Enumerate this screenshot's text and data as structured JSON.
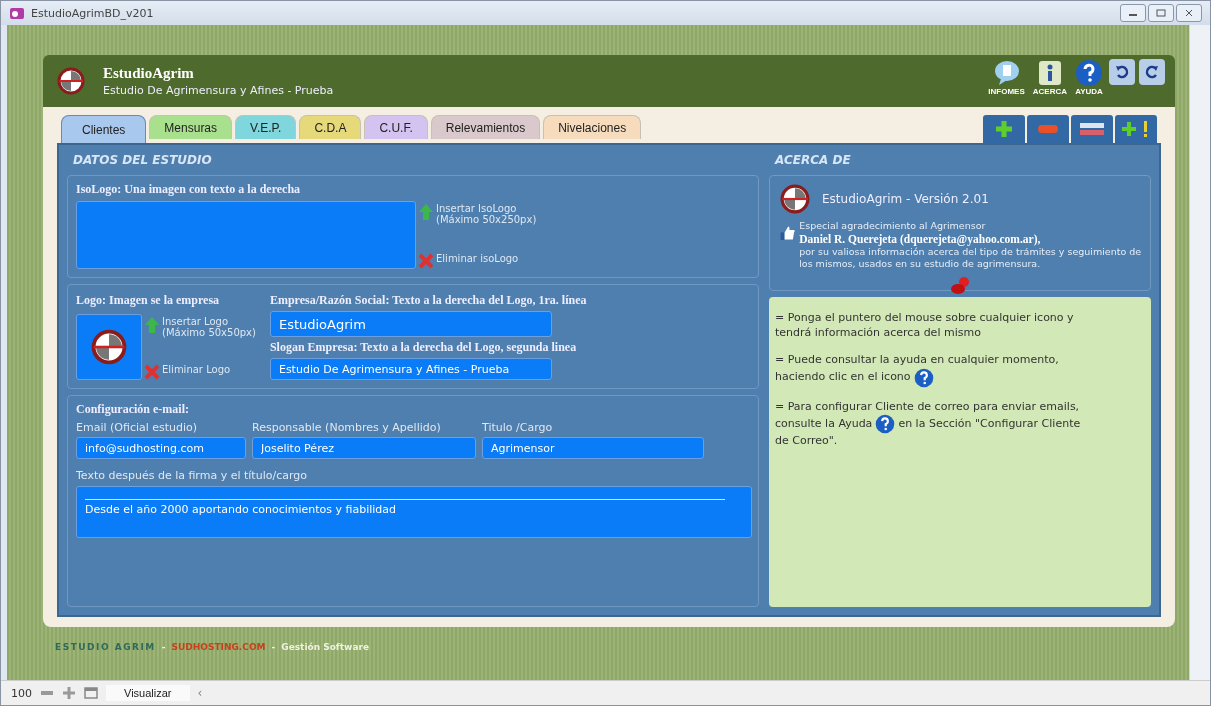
{
  "window": {
    "title": "EstudioAgrimBD_v201"
  },
  "header": {
    "title": "EstudioAgrim",
    "subtitle": "Estudio De Agrimensura y Afines - Prueba",
    "buttons": [
      {
        "kind": "infomes",
        "label": "INFOMES"
      },
      {
        "kind": "acerca",
        "label": "ACERCA"
      },
      {
        "kind": "ayuda",
        "label": "AYUDA"
      }
    ]
  },
  "tabs": [
    {
      "label": "Clientes",
      "selected": true,
      "color": "#a9c8ee"
    },
    {
      "label": "Mensuras",
      "selected": false,
      "color": "#a8e08e"
    },
    {
      "label": "V.E.P.",
      "selected": false,
      "color": "#7fd6dc"
    },
    {
      "label": "C.D.A",
      "selected": false,
      "color": "#e6d97a"
    },
    {
      "label": "C.U.F.",
      "selected": false,
      "color": "#d4c2f0"
    },
    {
      "label": "Relevamientos",
      "selected": false,
      "color": "#d9c9cc"
    },
    {
      "label": "Nivelaciones",
      "selected": false,
      "color": "#f6dcbc"
    }
  ],
  "toolbar": [
    {
      "kind": "add"
    },
    {
      "kind": "remove"
    },
    {
      "kind": "edit"
    },
    {
      "kind": "add-alert"
    }
  ],
  "datos": {
    "heading": "DATOS DEL ESTUDIO",
    "isologo": {
      "label": "IsoLogo: Una imagen con texto a la derecha",
      "insert": [
        "Insertar IsoLogo",
        "(Máximo 50x250px)"
      ],
      "delete": "Eliminar isoLogo"
    },
    "logo": {
      "label": "Logo: Imagen se la empresa",
      "insert": [
        "Insertar Logo",
        "(Máximo 50x50px)"
      ],
      "delete": "Eliminar Logo"
    },
    "empresa": {
      "label": "Empresa/Razón Social: Texto a la derecha del Logo, 1ra. línea",
      "value": "EstudioAgrim"
    },
    "slogan": {
      "label": "Slogan Empresa: Texto a la derecha del Logo, segunda linea",
      "value": "Estudio De Agrimensura y Afines - Prueba"
    },
    "email": {
      "heading": "Configuración e-mail:",
      "fields": [
        {
          "label": "Email (Oficial estudio)",
          "value": "info@sudhosting.com"
        },
        {
          "label": "Responsable (Nombres y Apellido)",
          "value": "Joselito Pérez"
        },
        {
          "label": "Titulo /Cargo",
          "value": "Agrimensor"
        }
      ],
      "firma_label": "Texto después de la firma y el título/cargo",
      "firma_value": "Desde el año 2000 aportando conocimientos y fiabilidad"
    }
  },
  "acerca": {
    "heading": "ACERCA DE",
    "version": "EstudioAgrim - Versión 2.01",
    "thanks": "Especial agradecimiento al Agrimensor",
    "name": "Daniel R. Querejeta (dquerejeta@yahoo.com.ar),",
    "thanks_rest": "por su valiosa información acerca del tipo de trámites y seguimiento de los mismos, usados en su estudio de agrimensura.",
    "notes": [
      {
        "items": [
          {
            "kind": "text",
            "text": "= Ponga el puntero del mouse sobre cualquier icono y"
          },
          {
            "kind": "break"
          },
          {
            "kind": "text",
            "text": "tendrá información acerca del mismo"
          }
        ]
      },
      {
        "items": [
          {
            "kind": "text",
            "text": "= Puede consultar la ayuda en cualquier momento,"
          },
          {
            "kind": "break"
          },
          {
            "kind": "text",
            "text": "haciendo clic en el icono"
          },
          {
            "kind": "help_icon"
          }
        ]
      },
      {
        "items": [
          {
            "kind": "text",
            "text": "= Para configurar Cliente de correo para enviar emails,"
          },
          {
            "kind": "break"
          },
          {
            "kind": "text",
            "text": "consulte la Ayuda"
          },
          {
            "kind": "help_icon"
          },
          {
            "kind": "text",
            "text": "en la Sección \"Configurar Cliente"
          },
          {
            "kind": "break"
          },
          {
            "kind": "text",
            "text": "de Correo\"."
          }
        ]
      }
    ]
  },
  "footer": [
    {
      "kind": "brand",
      "text": "ESTUDIO AGRIM"
    },
    {
      "kind": "sep",
      "text": "-"
    },
    {
      "kind": "host",
      "text": "SUDHOSTING.COM"
    },
    {
      "kind": "sep",
      "text": "-"
    },
    {
      "kind": "plain",
      "text": "Gestión Software"
    }
  ],
  "status_bar": {
    "zoom": "100",
    "view": "Visualizar",
    "arrow": "‹"
  }
}
